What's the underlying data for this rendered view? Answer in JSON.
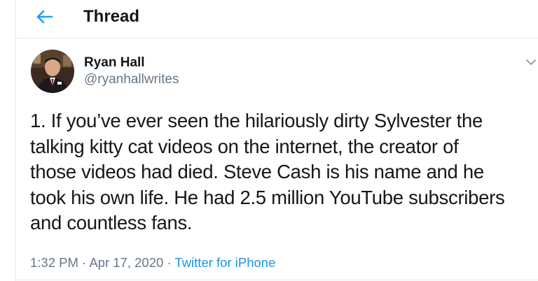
{
  "header": {
    "title": "Thread",
    "back_icon": "arrow-left-icon"
  },
  "tweet": {
    "author": {
      "name": "Ryan Hall",
      "handle": "@ryanhallwrites"
    },
    "text_lines": [
      "1. If you’ve ever seen the hilariously dirty Sylvester the",
      "talking kitty cat videos on the internet, the creator of",
      "those videos had died. Steve Cash is his name and he",
      "took his own life. He had 2.5 million YouTube subscribers",
      "and countless fans."
    ],
    "time": "1:32 PM",
    "separator": "·",
    "date": "Apr 17, 2020",
    "source": "Twitter for iPhone",
    "menu_icon": "chevron-down-icon"
  },
  "colors": {
    "accent": "#1da1f2",
    "text": "#14171a",
    "secondary": "#657786",
    "divider": "#e6ecf0"
  }
}
